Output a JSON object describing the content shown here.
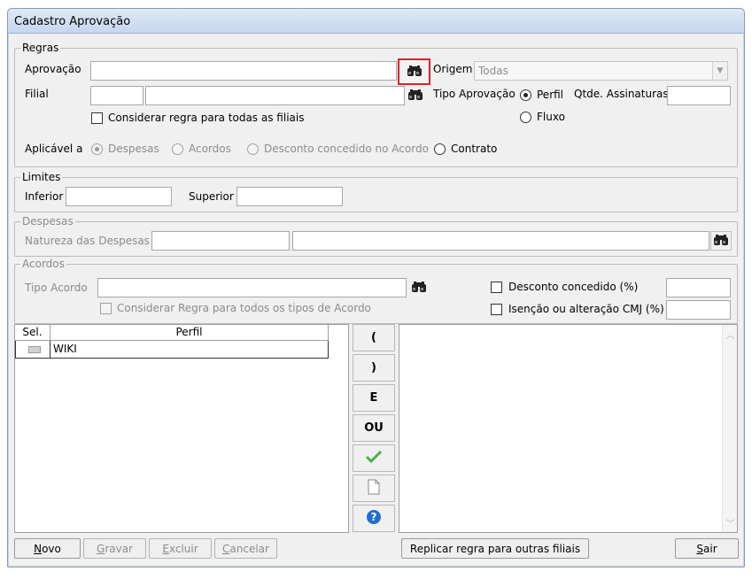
{
  "window": {
    "title": "Cadastro Aprovação"
  },
  "regras": {
    "legend": "Regras",
    "aprovacao_label": "Aprovação",
    "aprovacao_value": "",
    "origem_label": "Origem",
    "origem_value": "Todas",
    "filial_label": "Filial",
    "filial_code": "",
    "filial_name": "",
    "tipo_aprovacao_label": "Tipo Aprovação",
    "tipo_options": [
      "Perfil",
      "Fluxo"
    ],
    "tipo_selected": "Perfil",
    "qtde_assinaturas_label": "Qtde. Assinaturas",
    "qtde_assinaturas_value": "",
    "considerar_filiais_label": "Considerar regra para todas as filiais",
    "aplicavel_label": "Aplicável a",
    "aplicavel_options": [
      "Despesas",
      "Acordos",
      "Desconto concedido no Acordo",
      "Contrato"
    ],
    "aplicavel_selected": "Despesas"
  },
  "limites": {
    "legend": "Limites",
    "inferior_label": "Inferior",
    "inferior_value": "",
    "superior_label": "Superior",
    "superior_value": ""
  },
  "despesas": {
    "legend": "Despesas",
    "natureza_label": "Natureza das Despesas"
  },
  "acordos": {
    "legend": "Acordos",
    "tipo_acordo_label": "Tipo Acordo",
    "considerar_tipos_label": "Considerar Regra para todos os tipos de Acordo",
    "desconto_label": "Desconto concedido (%)",
    "isencao_label": "Isenção ou alteração CMJ (%)"
  },
  "grid": {
    "columns": [
      "Sel.",
      "Perfil"
    ],
    "rows": [
      {
        "perfil": "WIKI"
      }
    ]
  },
  "operators": [
    "(",
    ")",
    "E",
    "OU"
  ],
  "icons": {
    "search": "binoculars-icon",
    "confirm": "checkmark-icon",
    "new_page": "document-icon",
    "help": "help-icon"
  },
  "buttons": {
    "novo": "Novo",
    "gravar": "Gravar",
    "excluir": "Excluir",
    "cancelar": "Cancelar",
    "replicar": "Replicar regra para outras filiais",
    "sair": "Sair"
  },
  "colors": {
    "highlight": "#e0202a",
    "help_blue": "#1e6fd0",
    "check_green": "#4caf50"
  }
}
